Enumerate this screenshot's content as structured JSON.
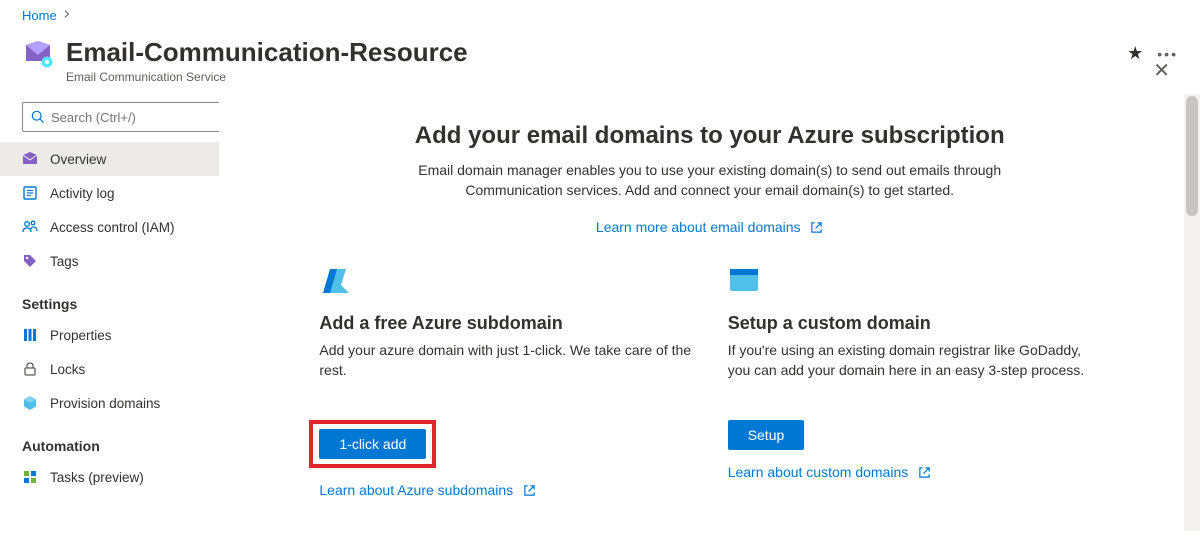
{
  "breadcrumb": {
    "home": "Home"
  },
  "header": {
    "title": "Email-Communication-Resource",
    "subtitle": "Email Communication Service"
  },
  "sidebar": {
    "search_placeholder": "Search (Ctrl+/)",
    "items": {
      "overview": "Overview",
      "activity_log": "Activity log",
      "access_control": "Access control (IAM)",
      "tags": "Tags"
    },
    "sections": {
      "settings": "Settings",
      "automation": "Automation"
    },
    "settings_items": {
      "properties": "Properties",
      "locks": "Locks",
      "provision_domains": "Provision domains"
    },
    "automation_items": {
      "tasks": "Tasks (preview)"
    }
  },
  "main": {
    "heading": "Add your email domains to your Azure subscription",
    "subheading": "Email domain manager enables you to use your existing domain(s) to send out emails through Communication services. Add and connect your email domain(s) to get started.",
    "learn_more": "Learn more about email domains",
    "card1": {
      "title": "Add a free Azure subdomain",
      "desc": "Add your azure domain with just 1-click. We take care of the rest.",
      "button": "1-click add",
      "learn": "Learn about Azure subdomains"
    },
    "card2": {
      "title": "Setup a custom domain",
      "desc": "If you're using an existing domain registrar like GoDaddy, you can add your domain here in an easy 3-step process.",
      "button": "Setup",
      "learn": "Learn about custom domains"
    }
  }
}
